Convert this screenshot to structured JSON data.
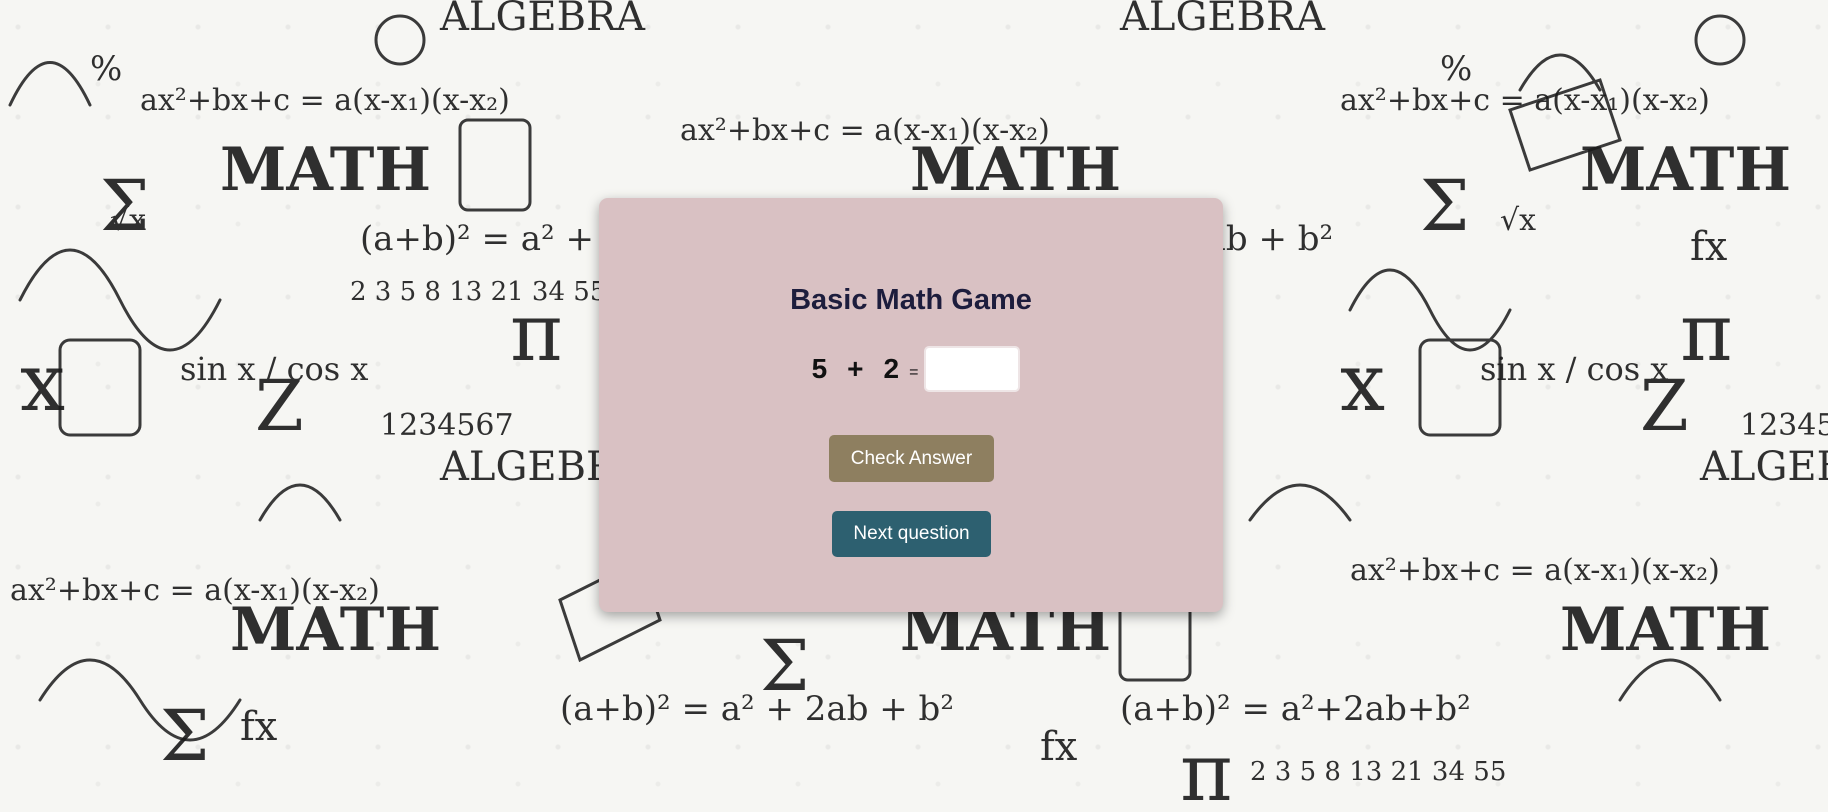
{
  "page": {
    "background": "math-doodle-wallpaper"
  },
  "game": {
    "title": "Basic Math Game",
    "operand_a": "5",
    "operator": "+",
    "operand_b": "2",
    "equals": "=",
    "answer_value": "",
    "check_label": "Check Answer",
    "next_label": "Next question"
  },
  "colors": {
    "card_bg": "#d9c1c3",
    "title_text": "#1d1d3d",
    "check_button": "#8e7f60",
    "next_button": "#2d6070"
  }
}
